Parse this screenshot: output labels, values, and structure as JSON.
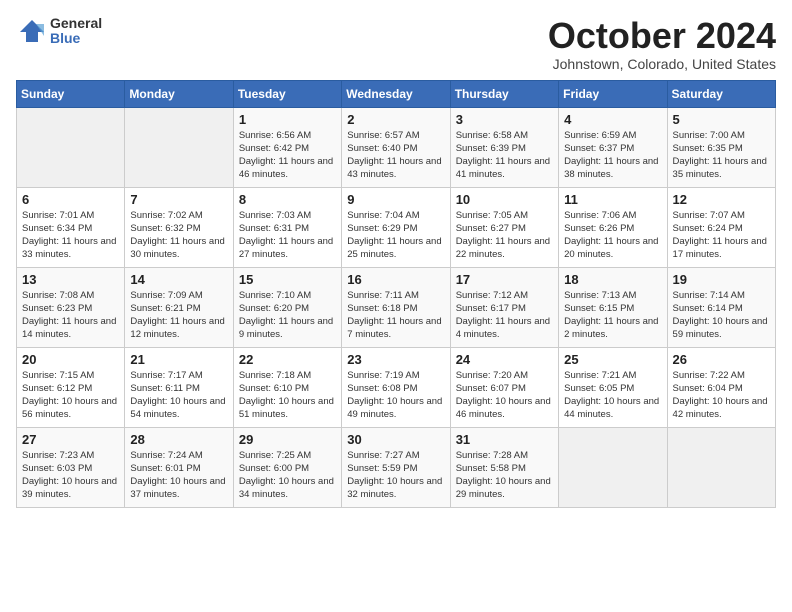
{
  "logo": {
    "general": "General",
    "blue": "Blue"
  },
  "title": {
    "month": "October 2024",
    "location": "Johnstown, Colorado, United States"
  },
  "weekdays": [
    "Sunday",
    "Monday",
    "Tuesday",
    "Wednesday",
    "Thursday",
    "Friday",
    "Saturday"
  ],
  "weeks": [
    [
      {
        "day": null
      },
      {
        "day": null
      },
      {
        "day": "1",
        "sunrise": "6:56 AM",
        "sunset": "6:42 PM",
        "daylight": "11 hours and 46 minutes."
      },
      {
        "day": "2",
        "sunrise": "6:57 AM",
        "sunset": "6:40 PM",
        "daylight": "11 hours and 43 minutes."
      },
      {
        "day": "3",
        "sunrise": "6:58 AM",
        "sunset": "6:39 PM",
        "daylight": "11 hours and 41 minutes."
      },
      {
        "day": "4",
        "sunrise": "6:59 AM",
        "sunset": "6:37 PM",
        "daylight": "11 hours and 38 minutes."
      },
      {
        "day": "5",
        "sunrise": "7:00 AM",
        "sunset": "6:35 PM",
        "daylight": "11 hours and 35 minutes."
      }
    ],
    [
      {
        "day": "6",
        "sunrise": "7:01 AM",
        "sunset": "6:34 PM",
        "daylight": "11 hours and 33 minutes."
      },
      {
        "day": "7",
        "sunrise": "7:02 AM",
        "sunset": "6:32 PM",
        "daylight": "11 hours and 30 minutes."
      },
      {
        "day": "8",
        "sunrise": "7:03 AM",
        "sunset": "6:31 PM",
        "daylight": "11 hours and 27 minutes."
      },
      {
        "day": "9",
        "sunrise": "7:04 AM",
        "sunset": "6:29 PM",
        "daylight": "11 hours and 25 minutes."
      },
      {
        "day": "10",
        "sunrise": "7:05 AM",
        "sunset": "6:27 PM",
        "daylight": "11 hours and 22 minutes."
      },
      {
        "day": "11",
        "sunrise": "7:06 AM",
        "sunset": "6:26 PM",
        "daylight": "11 hours and 20 minutes."
      },
      {
        "day": "12",
        "sunrise": "7:07 AM",
        "sunset": "6:24 PM",
        "daylight": "11 hours and 17 minutes."
      }
    ],
    [
      {
        "day": "13",
        "sunrise": "7:08 AM",
        "sunset": "6:23 PM",
        "daylight": "11 hours and 14 minutes."
      },
      {
        "day": "14",
        "sunrise": "7:09 AM",
        "sunset": "6:21 PM",
        "daylight": "11 hours and 12 minutes."
      },
      {
        "day": "15",
        "sunrise": "7:10 AM",
        "sunset": "6:20 PM",
        "daylight": "11 hours and 9 minutes."
      },
      {
        "day": "16",
        "sunrise": "7:11 AM",
        "sunset": "6:18 PM",
        "daylight": "11 hours and 7 minutes."
      },
      {
        "day": "17",
        "sunrise": "7:12 AM",
        "sunset": "6:17 PM",
        "daylight": "11 hours and 4 minutes."
      },
      {
        "day": "18",
        "sunrise": "7:13 AM",
        "sunset": "6:15 PM",
        "daylight": "11 hours and 2 minutes."
      },
      {
        "day": "19",
        "sunrise": "7:14 AM",
        "sunset": "6:14 PM",
        "daylight": "10 hours and 59 minutes."
      }
    ],
    [
      {
        "day": "20",
        "sunrise": "7:15 AM",
        "sunset": "6:12 PM",
        "daylight": "10 hours and 56 minutes."
      },
      {
        "day": "21",
        "sunrise": "7:17 AM",
        "sunset": "6:11 PM",
        "daylight": "10 hours and 54 minutes."
      },
      {
        "day": "22",
        "sunrise": "7:18 AM",
        "sunset": "6:10 PM",
        "daylight": "10 hours and 51 minutes."
      },
      {
        "day": "23",
        "sunrise": "7:19 AM",
        "sunset": "6:08 PM",
        "daylight": "10 hours and 49 minutes."
      },
      {
        "day": "24",
        "sunrise": "7:20 AM",
        "sunset": "6:07 PM",
        "daylight": "10 hours and 46 minutes."
      },
      {
        "day": "25",
        "sunrise": "7:21 AM",
        "sunset": "6:05 PM",
        "daylight": "10 hours and 44 minutes."
      },
      {
        "day": "26",
        "sunrise": "7:22 AM",
        "sunset": "6:04 PM",
        "daylight": "10 hours and 42 minutes."
      }
    ],
    [
      {
        "day": "27",
        "sunrise": "7:23 AM",
        "sunset": "6:03 PM",
        "daylight": "10 hours and 39 minutes."
      },
      {
        "day": "28",
        "sunrise": "7:24 AM",
        "sunset": "6:01 PM",
        "daylight": "10 hours and 37 minutes."
      },
      {
        "day": "29",
        "sunrise": "7:25 AM",
        "sunset": "6:00 PM",
        "daylight": "10 hours and 34 minutes."
      },
      {
        "day": "30",
        "sunrise": "7:27 AM",
        "sunset": "5:59 PM",
        "daylight": "10 hours and 32 minutes."
      },
      {
        "day": "31",
        "sunrise": "7:28 AM",
        "sunset": "5:58 PM",
        "daylight": "10 hours and 29 minutes."
      },
      {
        "day": null
      },
      {
        "day": null
      }
    ]
  ],
  "labels": {
    "sunrise": "Sunrise:",
    "sunset": "Sunset:",
    "daylight": "Daylight:"
  }
}
